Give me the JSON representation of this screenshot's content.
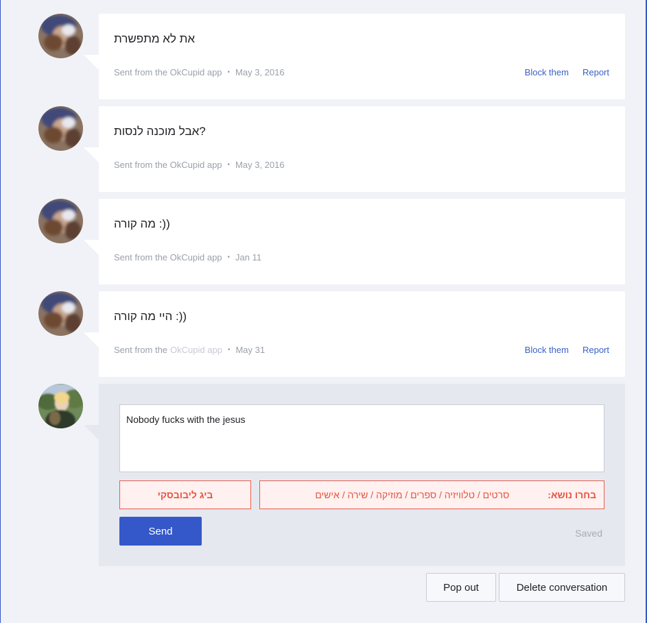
{
  "messages": [
    {
      "text": "את לא מתפשרת",
      "source": "Sent from the OkCupid app",
      "separator": "•",
      "date": "May 3, 2016",
      "block_label": "Block them",
      "report_label": "Report"
    },
    {
      "text": "אבל מוכנה לנסות?",
      "source": "Sent from the OkCupid app",
      "separator": "•",
      "date": "May 3, 2016"
    },
    {
      "text": "מה קורה :))",
      "source": "Sent from the OkCupid app",
      "separator": "•",
      "date": "Jan 11"
    },
    {
      "text": "היי מה קורה :))",
      "source_prefix": "Sent from the",
      "source_faded": "OkCupid app",
      "separator": "•",
      "date": "May 31",
      "block_label": "Block them",
      "report_label": "Report"
    }
  ],
  "compose": {
    "draft": "Nobody fucks with the jesus",
    "topic_button": "ביג ליבובסקי",
    "topic_label": "בחרו נושא:",
    "topic_categories": "סרטים / טלוויזיה / ספרים / מוזיקה / שירה / אישים",
    "send_label": "Send",
    "status": "Saved"
  },
  "footer": {
    "popout_label": "Pop out",
    "delete_label": "Delete conversation"
  },
  "colors": {
    "accent": "#3458c9",
    "link": "#3a61c7",
    "topic": "#e5543f",
    "background": "#f1f2f7"
  },
  "icons": {
    "other_avatar": "avatar-blurred-photo",
    "self_avatar": "avatar-outdoor-photo"
  }
}
